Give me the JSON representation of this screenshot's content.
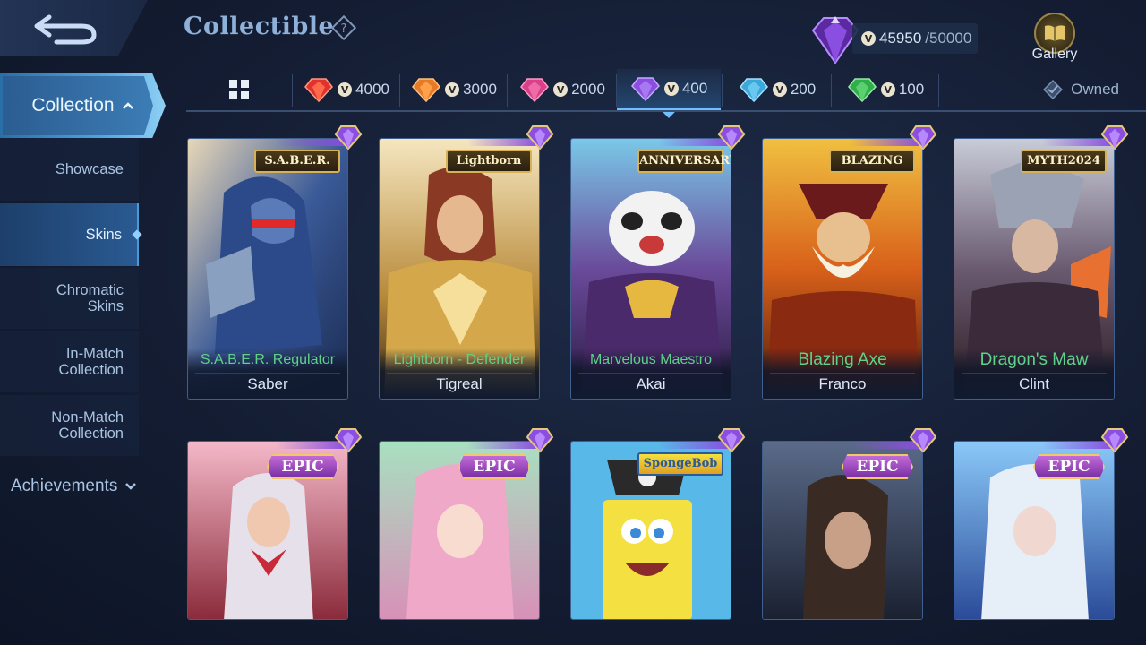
{
  "header": {
    "title": "Collectible",
    "points_current": "45950",
    "points_max": "/50000",
    "gallery_label": "Gallery"
  },
  "sidebar": {
    "collection_label": "Collection",
    "items": [
      {
        "label": "Showcase"
      },
      {
        "label": "Skins"
      },
      {
        "label": "Chromatic Skins"
      },
      {
        "label": "In-Match Collection"
      },
      {
        "label": "Non-Match Collection"
      }
    ],
    "achievements_label": "Achievements"
  },
  "tabs": [
    {
      "value": "4000",
      "gem_color": "#e0322e"
    },
    {
      "value": "3000",
      "gem_color": "#e67a25"
    },
    {
      "value": "2000",
      "gem_color": "#d8408a"
    },
    {
      "value": "400",
      "gem_color": "#8a4ee0",
      "active": true
    },
    {
      "value": "200",
      "gem_color": "#3aa8d8"
    },
    {
      "value": "100",
      "gem_color": "#2fae4a"
    }
  ],
  "owned_label": "Owned",
  "cards_row1": [
    {
      "badge": "S.A.B.E.R.",
      "skin": "S.A.B.E.R. Regulator",
      "hero": "Saber"
    },
    {
      "badge": "Lightborn",
      "skin": "Lightborn - Defender",
      "hero": "Tigreal"
    },
    {
      "badge": "ANNIVERSARY",
      "skin": "Marvelous Maestro",
      "hero": "Akai"
    },
    {
      "badge": "BLAZING",
      "skin": "Blazing Axe",
      "hero": "Franco"
    },
    {
      "badge": "MYTH2024",
      "skin": "Dragon's Maw",
      "hero": "Clint"
    }
  ],
  "cards_row2": [
    {
      "badge": "EPIC"
    },
    {
      "badge": "EPIC"
    },
    {
      "badge": "SpongeBob"
    },
    {
      "badge": "EPIC"
    },
    {
      "badge": "EPIC"
    }
  ],
  "colors": {
    "accent": "#6fc0ff",
    "skin_name": "#5fd18a",
    "purple_gem": "#8a4ee0"
  }
}
